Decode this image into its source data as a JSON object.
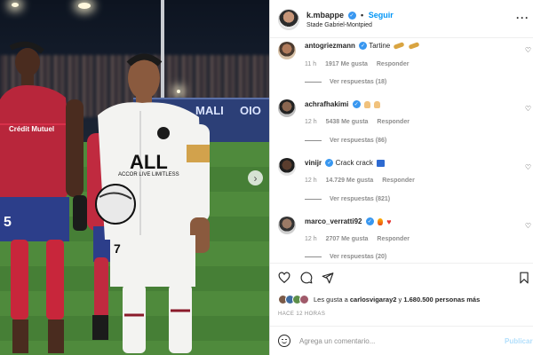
{
  "post": {
    "username": "k.mbappe",
    "follow_label": "Seguir",
    "separator": "•",
    "location": "Stade Gabriel-Montpied",
    "more_label": "···"
  },
  "photo": {
    "ad_text_left": "MALI",
    "ad_text_right": "OIO",
    "next_icon": "›",
    "icons": [
      "chevron-right-icon"
    ]
  },
  "comments": [
    {
      "username": "antogriezmann",
      "text": "Tartine",
      "emoji": [
        "baguette",
        "baguette"
      ],
      "time": "11 h",
      "likes": "1917 Me gusta",
      "reply": "Responder",
      "replies": "Ver respuestas (18)"
    },
    {
      "username": "achrafhakimi",
      "text": "",
      "emoji": [
        "raised-hands",
        "raised-hands"
      ],
      "time": "12 h",
      "likes": "5438 Me gusta",
      "reply": "Responder",
      "replies": "Ver respuestas (86)"
    },
    {
      "username": "vinijr",
      "text": "Crack crack",
      "emoji": [
        "flag"
      ],
      "time": "12 h",
      "likes": "14.729 Me gusta",
      "reply": "Responder",
      "replies": "Ver respuestas (821)"
    },
    {
      "username": "marco_verratti92",
      "text": "",
      "emoji": [
        "fire",
        "heart"
      ],
      "time": "12 h",
      "likes": "2707 Me gusta",
      "reply": "Responder",
      "replies": "Ver respuestas (20)"
    }
  ],
  "likes": {
    "prefix": "Les gusta a",
    "user": "carlosvigaray2",
    "suffix": "y",
    "count": "1.680.500 personas más"
  },
  "time_ago": "HACE 12 HORAS",
  "composer": {
    "placeholder": "Agrega un comentario...",
    "publish_label": "Publicar"
  },
  "colors": {
    "link_blue": "#0095f6",
    "verified_blue": "#3897f0",
    "muted_text": "#8e8e8e",
    "text": "#262626",
    "publish_disabled": "#b2dffc"
  }
}
